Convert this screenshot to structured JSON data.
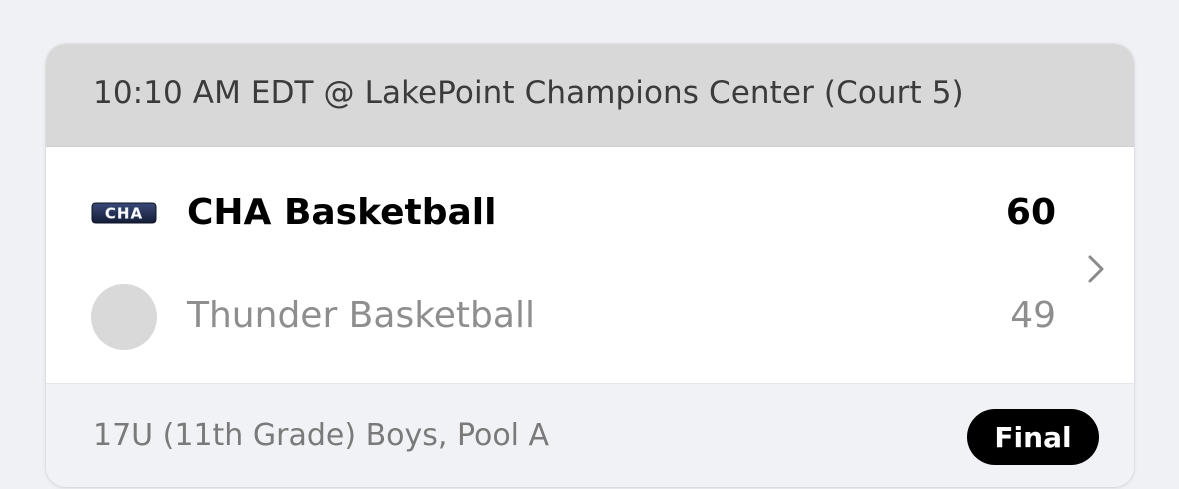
{
  "game": {
    "header": "10:10 AM EDT @ LakePoint Champions Center (Court 5)",
    "home": {
      "logo_text": "CHA",
      "name": "CHA Basketball",
      "score": "60"
    },
    "away": {
      "name": "Thunder Basketball",
      "score": "49"
    },
    "division": "17U (11th Grade) Boys, Pool A",
    "status": "Final"
  },
  "icons": {
    "chevron": "chevron-right-icon",
    "away_logo": "placeholder-circle"
  },
  "colors": {
    "header_bg": "#d8d8d8",
    "footer_bg": "#f1f2f5",
    "badge_bg": "#000000",
    "loser_text": "#8e8e8e",
    "logo_navy": "#1f2a4d"
  }
}
